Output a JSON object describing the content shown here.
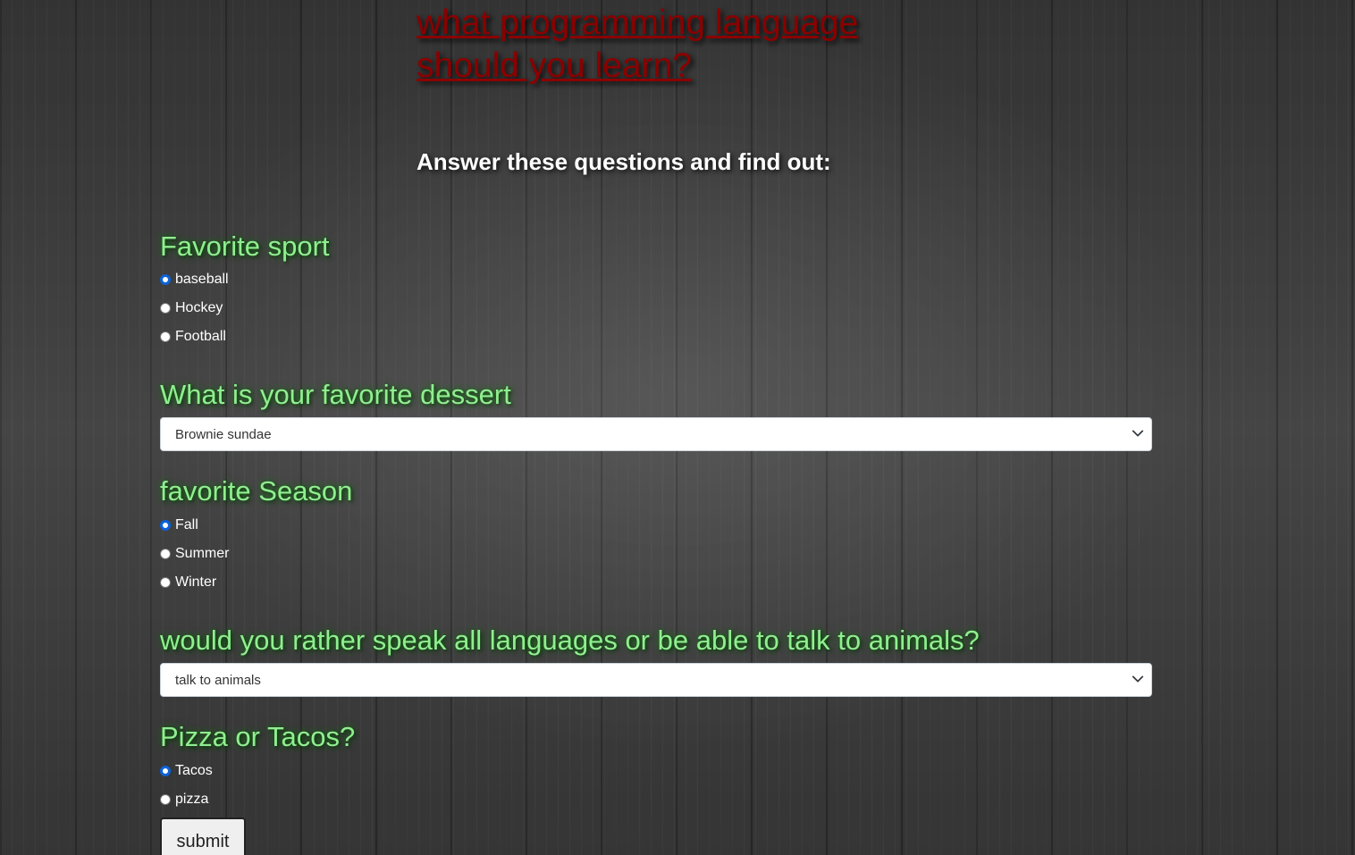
{
  "header": {
    "title": "what programming language should you learn?",
    "subtitle": "Answer these questions and find out:"
  },
  "questions": {
    "sport": {
      "label": "Favorite sport",
      "options": [
        "baseball",
        "Hockey",
        "Football"
      ],
      "selected": "baseball"
    },
    "dessert": {
      "label": "What is your favorite dessert",
      "value": "Brownie sundae"
    },
    "season": {
      "label": "favorite Season",
      "options": [
        "Fall",
        "Summer",
        "Winter"
      ],
      "selected": "Fall"
    },
    "languages": {
      "label": "would you rather speak all languages or be able to talk to animals?",
      "value": "talk to animals"
    },
    "food": {
      "label": "Pizza or Tacos?",
      "options": [
        "Tacos",
        "pizza"
      ],
      "selected": "Tacos"
    }
  },
  "form": {
    "submit_label": "submit"
  },
  "colors": {
    "title": "#8b0000",
    "question": "#90ee90",
    "radio_checked": "#0b63d8"
  },
  "icons": {
    "select_arrow": "chevron-down-icon"
  }
}
